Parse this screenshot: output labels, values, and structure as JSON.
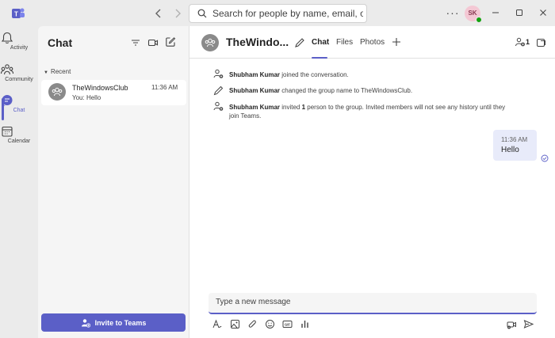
{
  "titlebar": {
    "search_placeholder": "Search for people by name, email, or phone number",
    "user_initials": "SK",
    "more_label": "···"
  },
  "rail": {
    "items": [
      {
        "label": "Activity",
        "icon": "bell-icon"
      },
      {
        "label": "Community",
        "icon": "community-icon"
      },
      {
        "label": "Chat",
        "icon": "chat-icon",
        "active": true
      },
      {
        "label": "Calendar",
        "icon": "calendar-icon"
      }
    ]
  },
  "chat_list": {
    "title": "Chat",
    "section": "Recent",
    "items": [
      {
        "name": "TheWindowsClub",
        "time": "11:36 AM",
        "preview": "You: Hello"
      }
    ],
    "invite_label": "Invite to Teams"
  },
  "conversation": {
    "title": "TheWindo...",
    "tabs": [
      {
        "label": "Chat",
        "active": true
      },
      {
        "label": "Files"
      },
      {
        "label": "Photos"
      }
    ],
    "participant_count": "1",
    "system_messages": [
      {
        "actor": "Shubham Kumar",
        "text": " joined the conversation.",
        "icon": "person-add-icon"
      },
      {
        "actor": "Shubham Kumar",
        "text": " changed the group name to TheWindowsClub.",
        "icon": "pencil-icon"
      },
      {
        "actor": "Shubham Kumar",
        "text_before": " invited ",
        "count": "1",
        "text_after": " person to the group. Invited members will not see any history until they join Teams.",
        "icon": "person-add-icon"
      }
    ],
    "messages": [
      {
        "time": "11:36 AM",
        "text": "Hello",
        "status": "seen"
      }
    ],
    "compose_placeholder": "Type a new message"
  },
  "colors": {
    "brand": "#5b5fc7",
    "bubble": "#e8ebfa",
    "presence": "#13a10e"
  }
}
